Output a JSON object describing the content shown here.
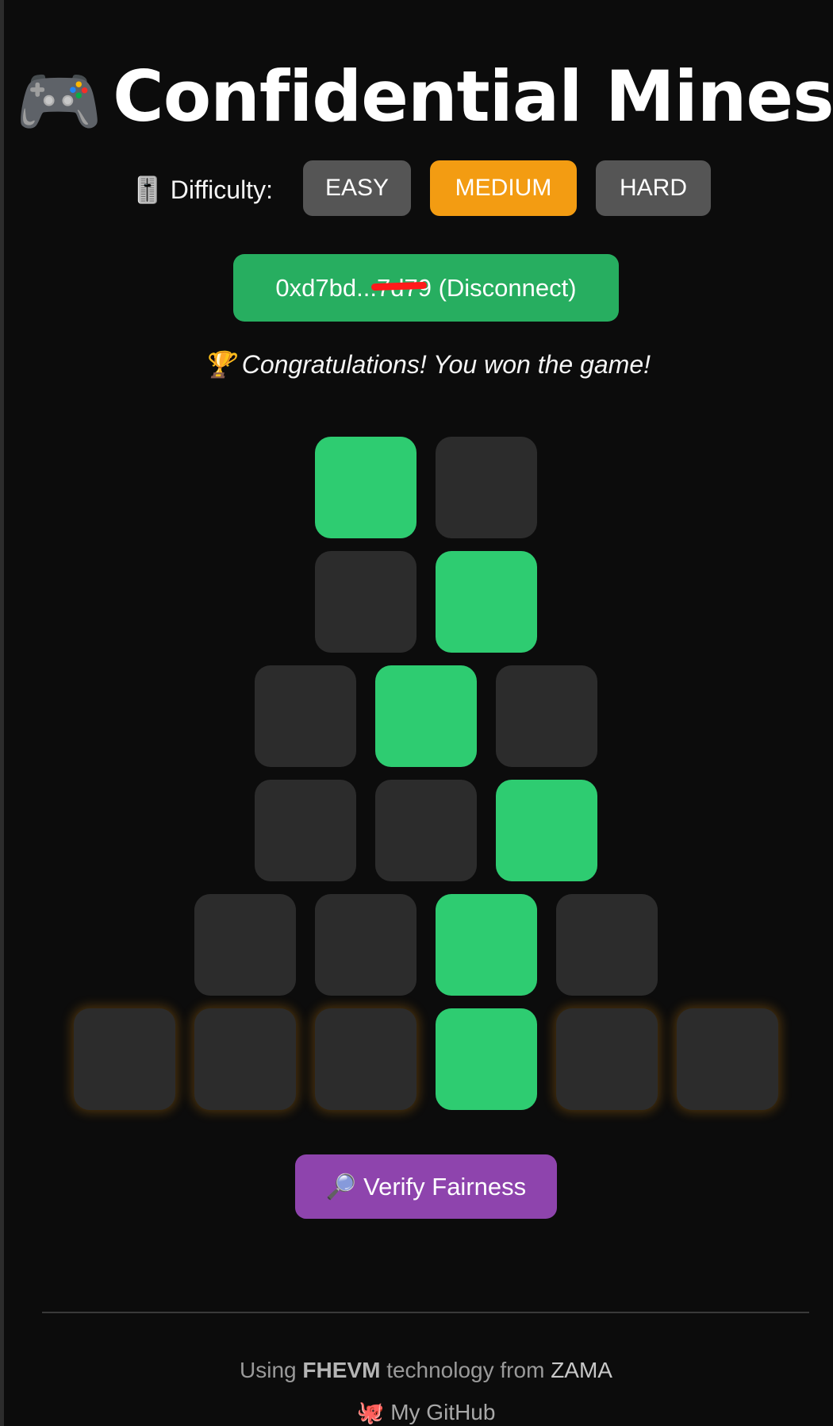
{
  "header": {
    "icon": "🎮",
    "title": "Confidential Mines"
  },
  "difficulty": {
    "icon": "🎚️",
    "label": "Difficulty:",
    "options": [
      "EASY",
      "MEDIUM",
      "HARD"
    ],
    "selected": "MEDIUM"
  },
  "wallet": {
    "address_start": "0xd7bd...",
    "address_end": "7d79",
    "disconnect_label": "(Disconnect)"
  },
  "status": {
    "icon": "🏆",
    "message": "Congratulations! You won the game!"
  },
  "board": {
    "rows": [
      [
        "safe",
        "hidden"
      ],
      [
        "hidden",
        "safe"
      ],
      [
        "hidden",
        "safe",
        "hidden"
      ],
      [
        "hidden",
        "hidden",
        "safe"
      ],
      [
        "hidden",
        "hidden",
        "safe",
        "hidden"
      ],
      [
        "hidden",
        "hidden",
        "hidden",
        "safe",
        "hidden",
        "hidden"
      ]
    ],
    "colors": {
      "safe": "#2ecc71",
      "hidden": "#2c2c2c",
      "current_row_glow": "#f39c12"
    }
  },
  "verify": {
    "icon": "🔎",
    "label": "Verify Fairness"
  },
  "footer": {
    "prefix": "Using",
    "tech": "FHEVM",
    "middle": "technology from",
    "brand": "ZAMA",
    "github_icon": "🐙",
    "github_label": "My GitHub"
  },
  "colors": {
    "background": "#0c0c0c",
    "accent_selected": "#f39c12",
    "wallet_green": "#27ae60",
    "verify_purple": "#8e44ad",
    "button_gray": "#555555"
  }
}
